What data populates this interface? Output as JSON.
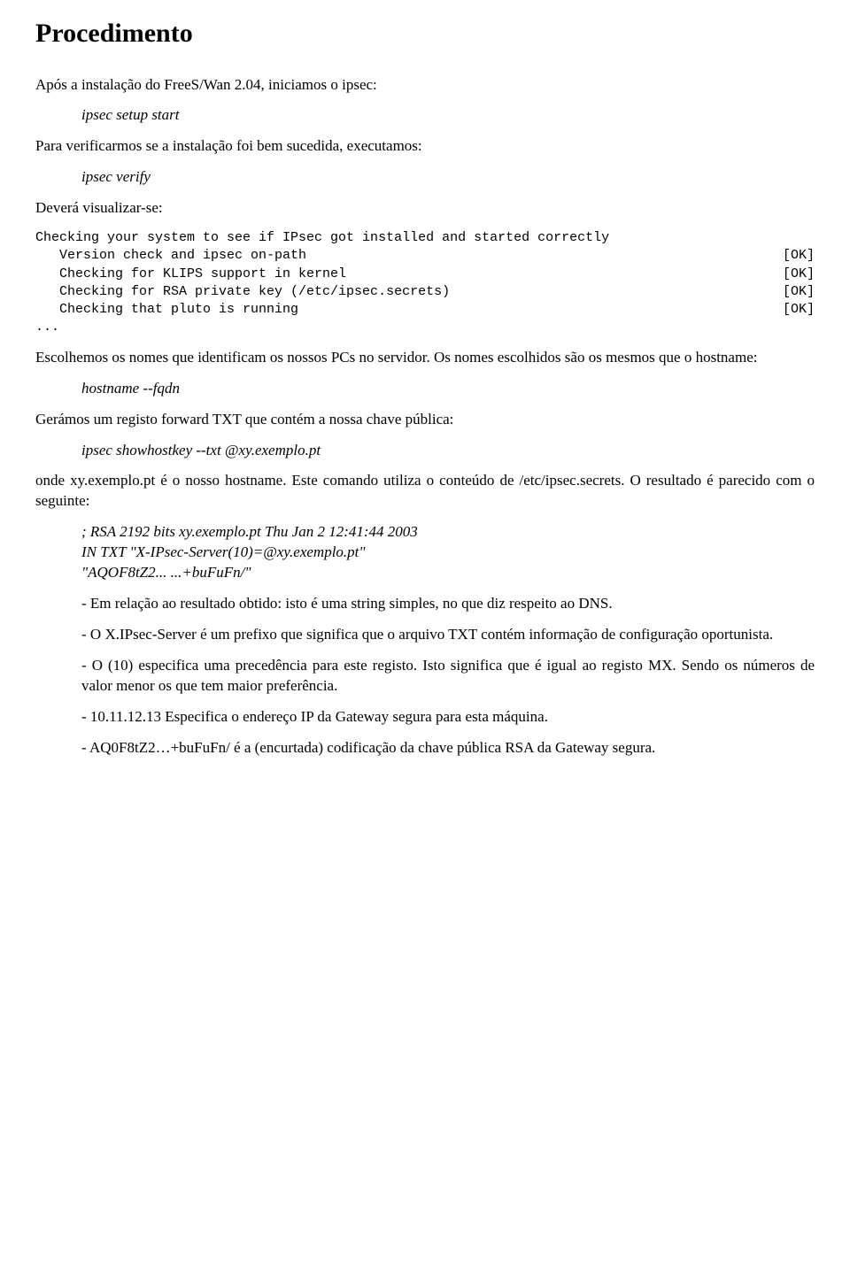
{
  "h1": "Procedimento",
  "p1": "Após a instalação do FreeS/Wan 2.04, iniciamos o ipsec:",
  "cmd1": "ipsec setup start",
  "p2": "Para verificarmos se a instalação foi bem sucedida, executamos:",
  "cmd2": "ipsec verify",
  "p3": "Deverá visualizar-se:",
  "check": {
    "line1": "Checking your system to see if IPsec got installed and started correctly",
    "rows": [
      {
        "l": "   Version check and ipsec on-path",
        "r": "[OK]"
      },
      {
        "l": "   Checking for KLIPS support in kernel",
        "r": "[OK]"
      },
      {
        "l": "   Checking for RSA private key (/etc/ipsec.secrets)",
        "r": "[OK]"
      },
      {
        "l": "   Checking that pluto is running",
        "r": "[OK]"
      }
    ],
    "ell": "..."
  },
  "p4": "Escolhemos os nomes que identificam os nossos PCs no servidor. Os nomes escolhidos são os mesmos que o hostname:",
  "cmd3": "hostname --fqdn",
  "p5": "Gerámos um registo forward TXT que contém a nossa chave pública:",
  "cmd4": "ipsec showhostkey --txt @xy.exemplo.pt",
  "p6": "onde xy.exemplo.pt é o nosso hostname. Este comando utiliza o conteúdo de /etc/ipsec.secrets. O resultado é parecido com o seguinte:",
  "snip1": "; RSA 2192 bits   xy.exemplo.pt   Thu Jan  2 12:41:44 2003",
  "snip2": "IN       TXT     \"X-IPsec-Server(10)=@xy.exemplo.pt\"",
  "snip3": "\"AQOF8tZ2... ...+buFuFn/\"",
  "b1": "- Em relação ao resultado obtido: isto é uma string simples, no que diz respeito ao DNS.",
  "b2": "- O X.IPsec-Server é um prefixo que significa que o arquivo TXT contém informação de configuração oportunista.",
  "b3": "- O (10) especifica uma precedência para este registo. Isto significa que é igual ao registo MX. Sendo os números de valor menor os que tem maior preferência.",
  "b4": "- 10.11.12.13 Especifica o endereço IP da Gateway segura para esta máquina.",
  "b5": "- AQ0F8tZ2…+buFuFn/ é a (encurtada) codificação da chave pública RSA da Gateway segura."
}
